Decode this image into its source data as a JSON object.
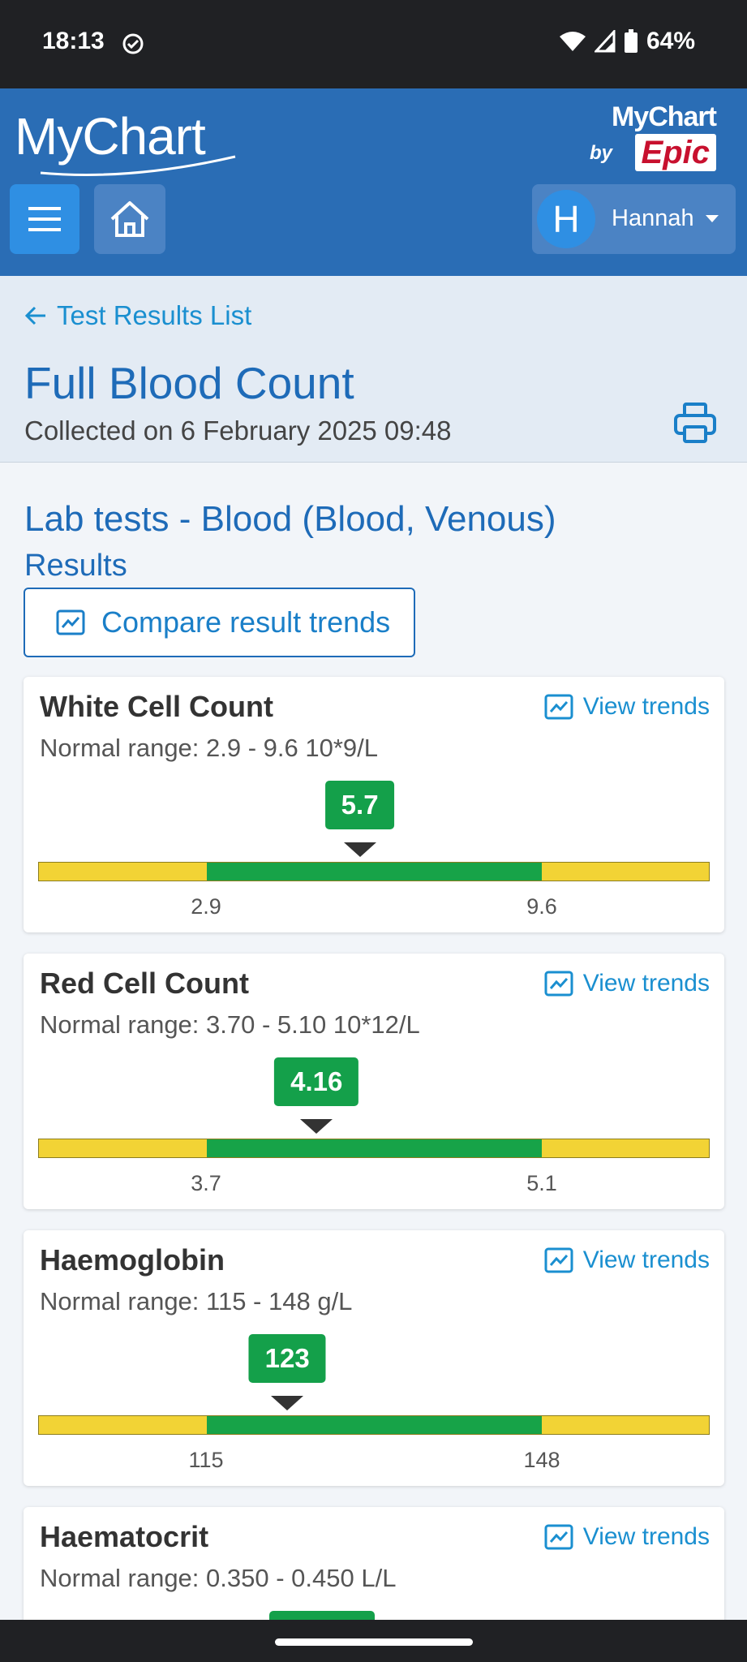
{
  "status_bar": {
    "time": "18:13",
    "battery": "64%"
  },
  "header": {
    "app_logo": "MyChart",
    "brand_top": "MyChart",
    "brand_by": "by",
    "brand_epic": "Epic",
    "user_initial": "H",
    "user_name": "Hannah",
    "menu_icon": "hamburger-icon",
    "home_icon": "home-icon"
  },
  "page": {
    "back_label": "Test Results List",
    "title": "Full Blood Count",
    "collected": "Collected on 6 February 2025 09:48",
    "section_title": "Lab tests - Blood (Blood, Venous)",
    "section_subtitle": "Results",
    "compare_label": "Compare result trends"
  },
  "results": [
    {
      "name": "White Cell Count",
      "range": "Normal range: 2.9 - 9.6 10*9/L",
      "value": "5.7",
      "low": "2.9",
      "high": "9.6",
      "trends": "View trends",
      "value_fraction": 0.458
    },
    {
      "name": "Red Cell Count",
      "range": "Normal range: 3.70 - 5.10 10*12/L",
      "value": "4.16",
      "low": "3.7",
      "high": "5.1",
      "trends": "View trends",
      "value_fraction": 0.329
    },
    {
      "name": "Haemoglobin",
      "range": "Normal range: 115 - 148 g/L",
      "value": "123",
      "low": "115",
      "high": "148",
      "trends": "View trends",
      "value_fraction": 0.242
    },
    {
      "name": "Haematocrit",
      "range": "Normal range: 0.350 - 0.450 L/L",
      "value": "",
      "low": "",
      "high": "",
      "trends": "View trends"
    }
  ],
  "colors": {
    "header": "#2a6db5",
    "accent": "#1a8fd0",
    "normal": "#17a348",
    "out_of_range": "#f2d335"
  }
}
